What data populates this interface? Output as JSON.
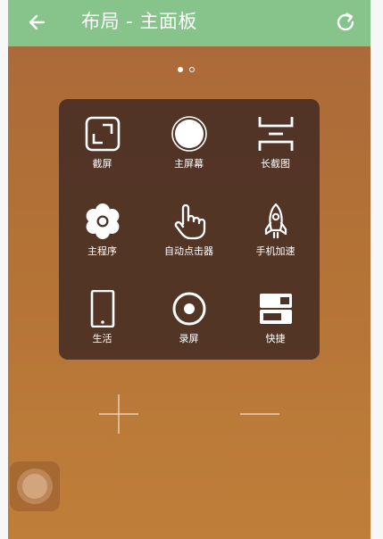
{
  "header": {
    "title": "布局 - 主面板",
    "back_icon": "arrow-left-icon",
    "refresh_icon": "refresh-icon",
    "background": "#86c48c"
  },
  "pager": {
    "total": 2,
    "current": 1
  },
  "panel": {
    "items": [
      {
        "label": "截屏",
        "icon": "screenshot-icon"
      },
      {
        "label": "主屏幕",
        "icon": "home-circle-icon"
      },
      {
        "label": "长截图",
        "icon": "long-screenshot-icon"
      },
      {
        "label": "主程序",
        "icon": "flower-icon"
      },
      {
        "label": "自动点击器",
        "icon": "hand-pointer-icon"
      },
      {
        "label": "手机加速",
        "icon": "rocket-icon"
      },
      {
        "label": "生活",
        "icon": "phone-icon"
      },
      {
        "label": "录屏",
        "icon": "record-icon"
      },
      {
        "label": "快捷",
        "icon": "shortcut-toggle-icon"
      }
    ]
  },
  "controls": {
    "add_icon": "plus-icon",
    "remove_icon": "minus-icon"
  },
  "floating_ball": {
    "icon": "assistive-ball-icon"
  }
}
